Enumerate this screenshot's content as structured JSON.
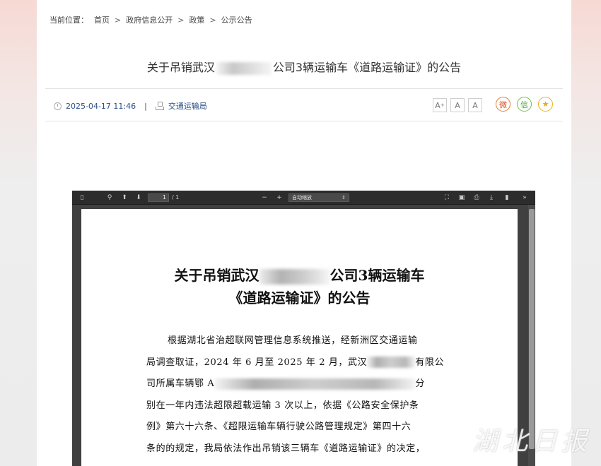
{
  "breadcrumb": {
    "label": "当前位置：",
    "items": [
      "首页",
      "政府信息公开",
      "政策",
      "公示公告"
    ],
    "separator": ">"
  },
  "article": {
    "title_start": "关于吊销武汉",
    "title_end": "公司3辆运输车《道路运输证》的公告",
    "datetime": "2025-04-17 11:46",
    "divider": "|",
    "source": "交通运输局",
    "font_sizes": [
      "A",
      "A",
      "A"
    ]
  },
  "share": {
    "weibo": "微",
    "wechat": "信",
    "favorite": "★"
  },
  "pdf_viewer": {
    "page_input": "1",
    "page_count": "/ 1",
    "zoom_value": "自动缩放",
    "zoom_out": "−",
    "zoom_in": "+",
    "doc_title_line1_start": "关于吊销武汉",
    "doc_title_line1_end": "公司3辆运输车",
    "doc_title_line2": "《道路运输证》的公告",
    "body_lines": [
      "根据湖北省治超联网管理信息系统推送，经新洲区交通运输",
      "局调查取证，2024 年 6 月至 2025 年 2 月，武汉",
      "有限公",
      "司所属车辆鄂 A",
      "分",
      "别在一年内违法超限超载运输 3 次以上，依据《公路安全保护条",
      "例》第六十六条、《超限运输车辆行驶公路管理规定》第四十六",
      "条的的规定，我局依法作出吊销该三辆车《道路运输证》的决定，"
    ]
  },
  "watermark": "湖北日报",
  "colors": {
    "meta_blue": "#2c4f8a",
    "weibo": "#e0491f",
    "wechat": "#4aa83a",
    "favorite": "#e8a710",
    "viewer_bg": "#404040",
    "toolbar_bg": "#2c2c2c"
  },
  "icons": {
    "sidebar_toggle": "sidebar-toggle-icon",
    "search": "search-icon",
    "prev_page": "arrow-up-icon",
    "next_page": "arrow-down-icon",
    "presentation": "fullscreen-icon",
    "open": "open-file-icon",
    "print": "print-icon",
    "download": "download-icon",
    "bookmark": "bookmark-icon",
    "tools": "double-chevron-right-icon"
  }
}
